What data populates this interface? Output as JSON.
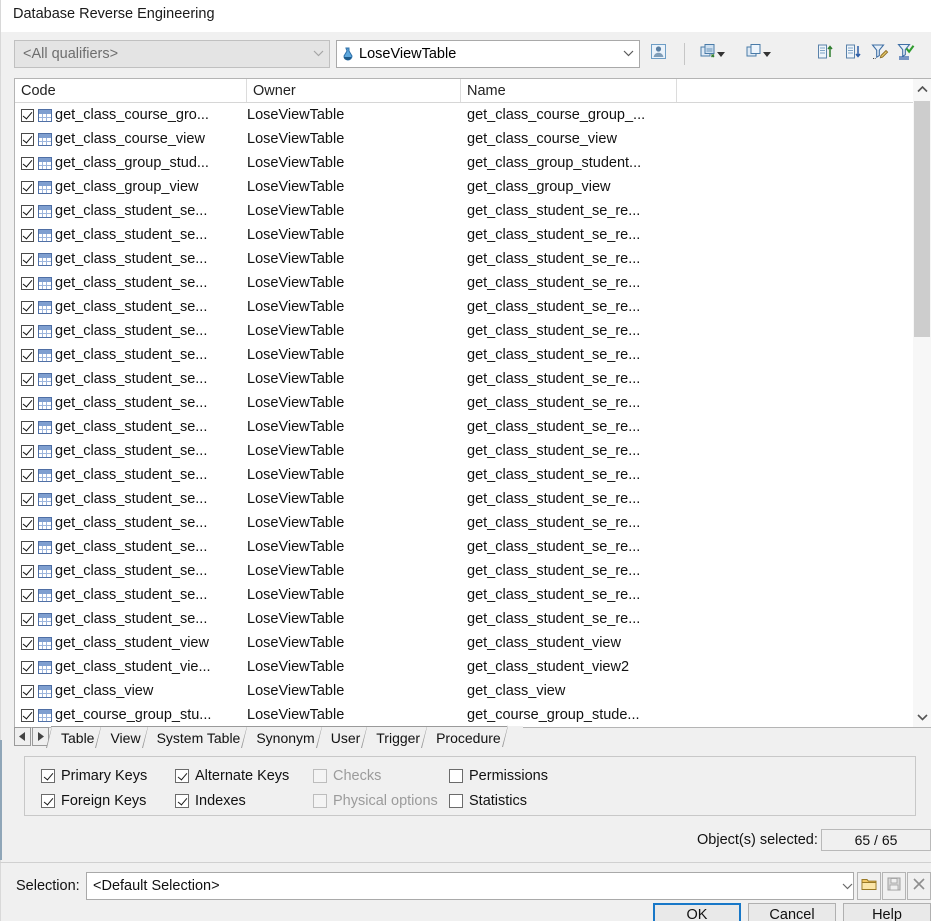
{
  "window": {
    "title": "Database Reverse Engineering"
  },
  "toolbar": {
    "qualifier_combo": {
      "value": "<All qualifiers>",
      "enabled": false
    },
    "database_combo": {
      "value": "LoseViewTable",
      "icon": "database-icon"
    },
    "buttons": [
      {
        "name": "user-filter-button",
        "icon": "user-icon"
      },
      {
        "name": "select-all-button",
        "icon": "copy-stack-icon",
        "has_caret": true
      },
      {
        "name": "deselect-all-button",
        "icon": "copy-single-icon",
        "has_caret": true
      },
      {
        "name": "sort-ascending-button",
        "icon": "sort-asc-icon"
      },
      {
        "name": "sort-descending-button",
        "icon": "sort-desc-icon"
      },
      {
        "name": "edit-filter-button",
        "icon": "funnel-edit-icon"
      },
      {
        "name": "apply-filter-button",
        "icon": "funnel-check-icon"
      }
    ]
  },
  "list": {
    "columns": [
      "Code",
      "Owner",
      "Name"
    ],
    "rows": [
      {
        "checked": true,
        "code": "get_class_course_gro...",
        "owner": "LoseViewTable",
        "name": "get_class_course_group_..."
      },
      {
        "checked": true,
        "code": "get_class_course_view",
        "owner": "LoseViewTable",
        "name": "get_class_course_view"
      },
      {
        "checked": true,
        "code": "get_class_group_stud...",
        "owner": "LoseViewTable",
        "name": "get_class_group_student..."
      },
      {
        "checked": true,
        "code": "get_class_group_view",
        "owner": "LoseViewTable",
        "name": "get_class_group_view"
      },
      {
        "checked": true,
        "code": "get_class_student_se...",
        "owner": "LoseViewTable",
        "name": "get_class_student_se_re..."
      },
      {
        "checked": true,
        "code": "get_class_student_se...",
        "owner": "LoseViewTable",
        "name": "get_class_student_se_re..."
      },
      {
        "checked": true,
        "code": "get_class_student_se...",
        "owner": "LoseViewTable",
        "name": "get_class_student_se_re..."
      },
      {
        "checked": true,
        "code": "get_class_student_se...",
        "owner": "LoseViewTable",
        "name": "get_class_student_se_re..."
      },
      {
        "checked": true,
        "code": "get_class_student_se...",
        "owner": "LoseViewTable",
        "name": "get_class_student_se_re..."
      },
      {
        "checked": true,
        "code": "get_class_student_se...",
        "owner": "LoseViewTable",
        "name": "get_class_student_se_re..."
      },
      {
        "checked": true,
        "code": "get_class_student_se...",
        "owner": "LoseViewTable",
        "name": "get_class_student_se_re..."
      },
      {
        "checked": true,
        "code": "get_class_student_se...",
        "owner": "LoseViewTable",
        "name": "get_class_student_se_re..."
      },
      {
        "checked": true,
        "code": "get_class_student_se...",
        "owner": "LoseViewTable",
        "name": "get_class_student_se_re..."
      },
      {
        "checked": true,
        "code": "get_class_student_se...",
        "owner": "LoseViewTable",
        "name": "get_class_student_se_re..."
      },
      {
        "checked": true,
        "code": "get_class_student_se...",
        "owner": "LoseViewTable",
        "name": "get_class_student_se_re..."
      },
      {
        "checked": true,
        "code": "get_class_student_se...",
        "owner": "LoseViewTable",
        "name": "get_class_student_se_re..."
      },
      {
        "checked": true,
        "code": "get_class_student_se...",
        "owner": "LoseViewTable",
        "name": "get_class_student_se_re..."
      },
      {
        "checked": true,
        "code": "get_class_student_se...",
        "owner": "LoseViewTable",
        "name": "get_class_student_se_re..."
      },
      {
        "checked": true,
        "code": "get_class_student_se...",
        "owner": "LoseViewTable",
        "name": "get_class_student_se_re..."
      },
      {
        "checked": true,
        "code": "get_class_student_se...",
        "owner": "LoseViewTable",
        "name": "get_class_student_se_re..."
      },
      {
        "checked": true,
        "code": "get_class_student_se...",
        "owner": "LoseViewTable",
        "name": "get_class_student_se_re..."
      },
      {
        "checked": true,
        "code": "get_class_student_se...",
        "owner": "LoseViewTable",
        "name": "get_class_student_se_re..."
      },
      {
        "checked": true,
        "code": "get_class_student_view",
        "owner": "LoseViewTable",
        "name": "get_class_student_view"
      },
      {
        "checked": true,
        "code": "get_class_student_vie...",
        "owner": "LoseViewTable",
        "name": "get_class_student_view2"
      },
      {
        "checked": true,
        "code": "get_class_view",
        "owner": "LoseViewTable",
        "name": "get_class_view"
      },
      {
        "checked": true,
        "code": "get_course_group_stu...",
        "owner": "LoseViewTable",
        "name": "get_course_group_stude..."
      }
    ]
  },
  "tabs": {
    "nav_prev": "◀",
    "nav_next": "▶",
    "items": [
      {
        "label": "Table",
        "active": true
      },
      {
        "label": "View",
        "active": false
      },
      {
        "label": "System Table",
        "active": false
      },
      {
        "label": "Synonym",
        "active": false
      },
      {
        "label": "User",
        "active": false
      },
      {
        "label": "Trigger",
        "active": false
      },
      {
        "label": "Procedure",
        "active": false
      }
    ]
  },
  "options": [
    {
      "label": "Primary Keys",
      "checked": true,
      "enabled": true
    },
    {
      "label": "Foreign Keys",
      "checked": true,
      "enabled": true
    },
    {
      "label": "Alternate Keys",
      "checked": true,
      "enabled": true
    },
    {
      "label": "Indexes",
      "checked": true,
      "enabled": true
    },
    {
      "label": "Checks",
      "checked": false,
      "enabled": false
    },
    {
      "label": "Physical options",
      "checked": false,
      "enabled": false
    },
    {
      "label": "Permissions",
      "checked": false,
      "enabled": true
    },
    {
      "label": "Statistics",
      "checked": false,
      "enabled": true
    }
  ],
  "status": {
    "label": "Object(s) selected:",
    "value": "65 / 65"
  },
  "selection": {
    "label": "Selection:",
    "value": "<Default Selection>",
    "buttons": [
      {
        "name": "open-selection-button",
        "icon": "folder-icon",
        "enabled": true
      },
      {
        "name": "save-selection-button",
        "icon": "save-icon",
        "enabled": false
      },
      {
        "name": "delete-selection-button",
        "icon": "close-icon",
        "enabled": false
      }
    ]
  },
  "footer": {
    "ok": "OK",
    "cancel": "Cancel",
    "help": "Help"
  },
  "colors": {
    "accent": "#1878c8",
    "dialog_bg": "#f0f0f0",
    "list_bg": "#ffffff"
  }
}
